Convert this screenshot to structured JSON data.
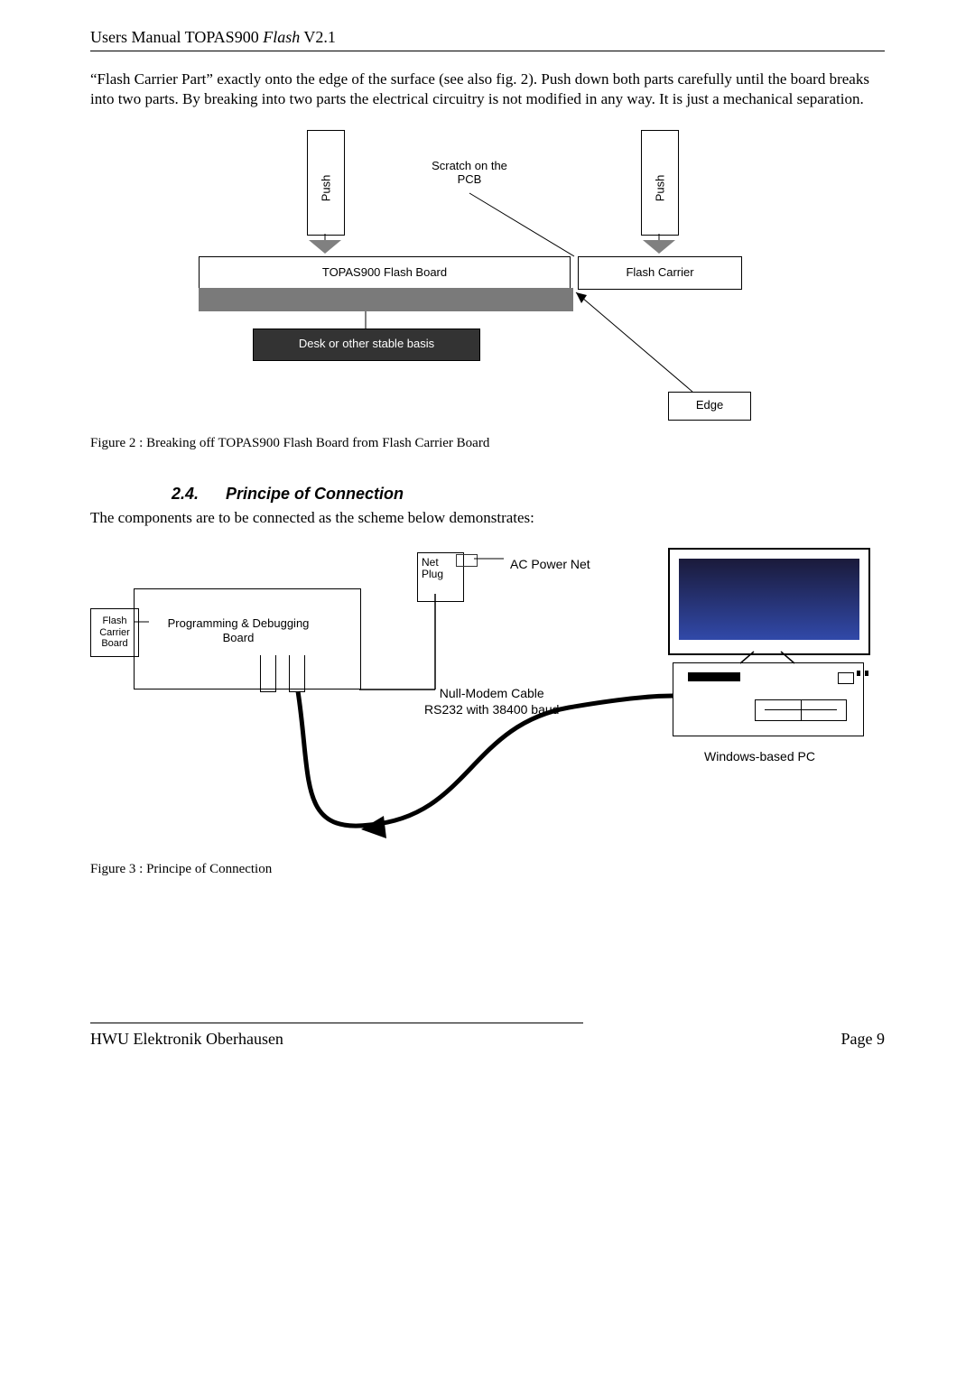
{
  "header": {
    "title_pre": "Users Manual TOPAS900 ",
    "title_italic": "Flash",
    "title_post": " V2.1"
  },
  "para1": "“Flash Carrier Part” exactly onto the edge of the surface (see also fig. 2). Push down both parts carefully until the board breaks into two parts. By breaking into two parts the electrical circuitry is not modified in any way. It is just a mechanical separation.",
  "fig1": {
    "push": "Push",
    "scratch_line1": "Scratch on the",
    "scratch_line2": "PCB",
    "flash_board": "TOPAS900 Flash Board",
    "flash_carrier": "Flash Carrier",
    "desk": "Desk or other stable basis",
    "edge": "Edge"
  },
  "caption1": "Figure 2 : Breaking off TOPAS900 Flash Board from Flash Carrier Board",
  "section": {
    "num": "2.4.",
    "title": "Principe of Connection"
  },
  "para2": "The components are to be connected as the scheme below demonstrates:",
  "fig2": {
    "flash_carrier_line1": "Flash",
    "flash_carrier_line2": "Carrier",
    "flash_carrier_line3": "Board",
    "prog": "Programming & Debugging\nBoard",
    "net_plug_line1": "Net",
    "net_plug_line2": "Plug",
    "ac": "AC Power Net",
    "null_line1": "Null-Modem Cable",
    "null_line2": "RS232 with 38400 baud",
    "pc": "Windows-based PC"
  },
  "caption2": "Figure 3 : Principe of Connection",
  "footer": {
    "left": "HWU Elektronik Oberhausen",
    "right": "Page 9"
  }
}
